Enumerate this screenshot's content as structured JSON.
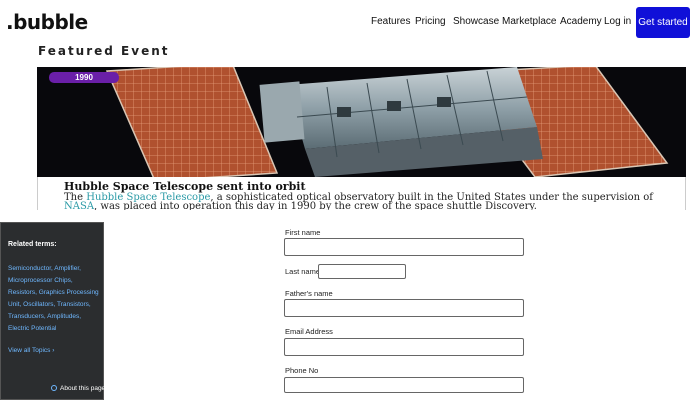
{
  "nav": {
    "logo": ".bubble",
    "links": [
      "Features",
      "Pricing",
      "Showcase",
      "Marketplace",
      "Academy",
      "Log in"
    ],
    "cta": "Get started"
  },
  "featured": {
    "heading": "Featured Event",
    "year": "1990",
    "title": "Hubble Space Telescope sent into orbit",
    "desc_pre": "The ",
    "desc_link1": "Hubble Space Telescope",
    "desc_mid": ", a sophisticated optical observatory built in the United States under the supervision of ",
    "desc_link2": "NASA",
    "desc_post": ", was placed into operation this day in 1990 by the crew of the space shuttle Discovery."
  },
  "related": {
    "heading": "Related terms:",
    "terms": "Semiconductor, Amplifier, Microprocessor Chips, Resistors, Graphics Processing Unit, Oscillators, Transistors, Transducers, Amplitudes, Electric Potential",
    "view_all": "View all Topics",
    "about": "About this page"
  },
  "form": {
    "first_name": "First name",
    "last_name": "Last name",
    "fathers_name": "Father's name",
    "email": "Email Address",
    "phone": "Phone No"
  },
  "colors": {
    "cta": "#1010d8",
    "badge": "#6a1fa8",
    "link": "#2a9aa6",
    "panel": "#2b2d2f"
  }
}
